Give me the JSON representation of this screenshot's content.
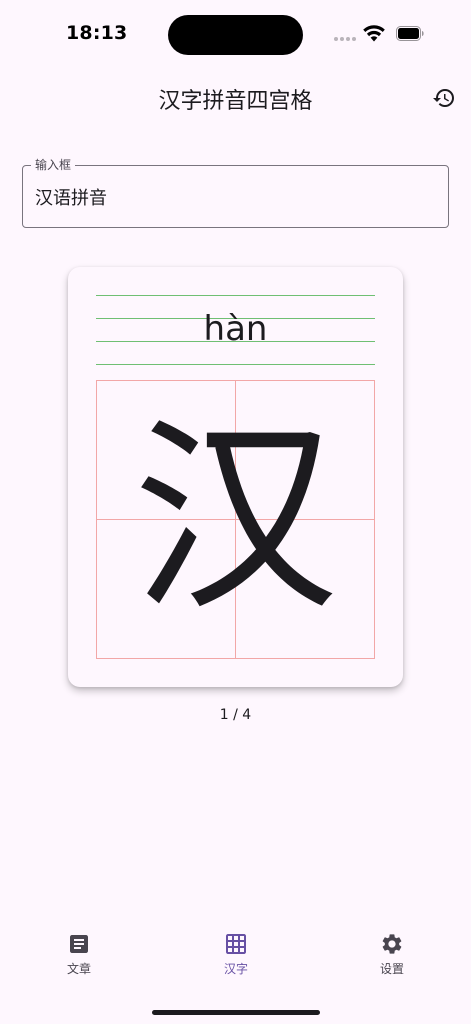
{
  "status_bar": {
    "time": "18:13"
  },
  "app_bar": {
    "title": "汉字拼音四宫格",
    "history_icon": "history-icon"
  },
  "input": {
    "label": "输入框",
    "value": "汉语拼音"
  },
  "card": {
    "pinyin": "hàn",
    "character": "汉"
  },
  "pager": {
    "text": "1 / 4"
  },
  "bottom_nav": {
    "items": [
      {
        "label": "文章",
        "icon": "article-icon",
        "active": false
      },
      {
        "label": "汉字",
        "icon": "grid-icon",
        "active": true
      },
      {
        "label": "设置",
        "icon": "gear-icon",
        "active": false
      }
    ]
  },
  "colors": {
    "background": "#FEF7FE",
    "accent": "#6750A4",
    "pinyin_lines": "#6FBF73",
    "tianzige_lines": "#F2A7A7",
    "text": "#1C1B1F"
  }
}
